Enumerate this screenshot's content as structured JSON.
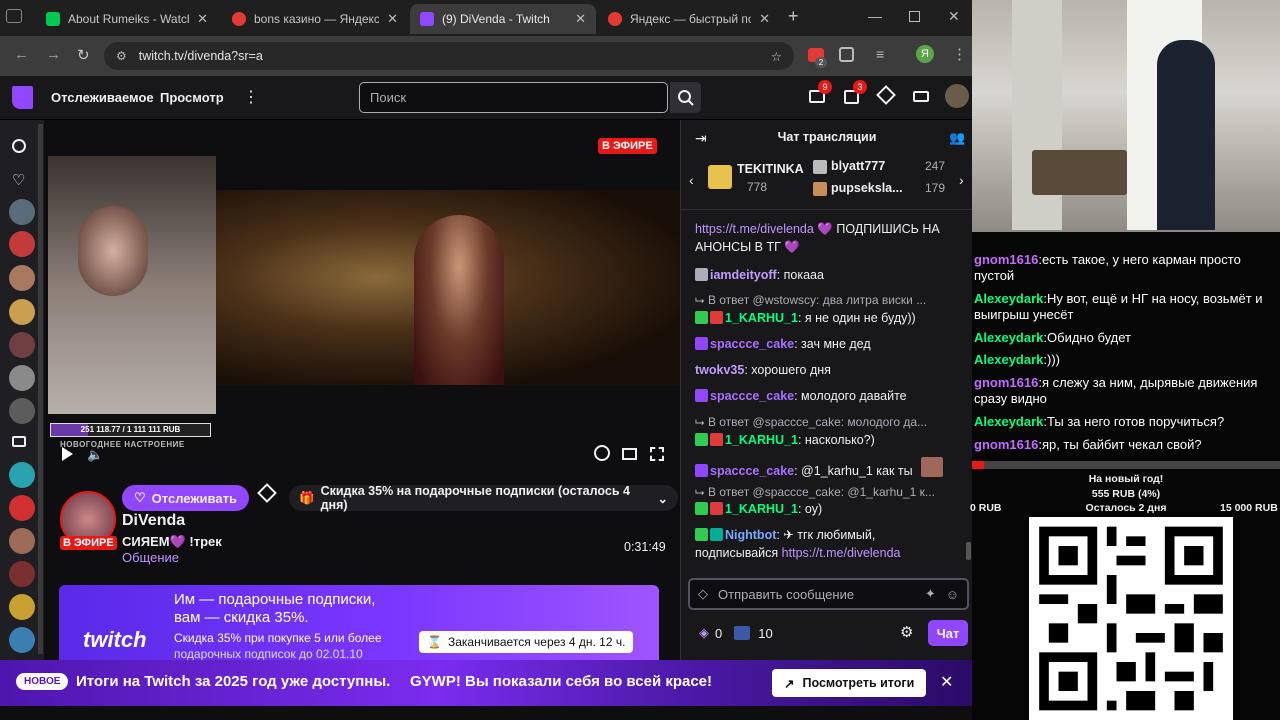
{
  "browser": {
    "tabs": [
      {
        "title": "About Rumeiks - Watch Li",
        "color": "#00c853"
      },
      {
        "title": "bons казино — Яндекс: на",
        "color": "#e53935"
      },
      {
        "title": "(9) DiVenda - Twitch",
        "color": "#9146ff"
      },
      {
        "title": "Яндекс — быстрый поиск",
        "color": "#e53935"
      }
    ],
    "url": "twitch.tv/divenda?sr=a",
    "profile_initial": "Я",
    "ext_badge": "2"
  },
  "nav": {
    "following": "Отслеживаемое",
    "browse": "Просмотр",
    "search_placeholder": "Поиск",
    "inbox_count": "9",
    "notif_count": "3"
  },
  "player": {
    "live_badge": "В ЭФИРЕ",
    "cam_progress_text": "251 118.77 / 1 111 111 RUB",
    "cam_caption": "НОВОГОДНЕЕ НАСТРОЕНИЕ",
    "progress_fraction": 0.23
  },
  "channel": {
    "name": "DiVenda",
    "live_badge": "В ЭФИРЕ",
    "title": "СИЯЕМ💜 !трек",
    "category": "Общение",
    "uptime": "0:31:49",
    "follow_label": "Отслеживать",
    "promo_label": "Скидка 35% на подарочные подписки (осталось 4 дня)"
  },
  "banner": {
    "line1": "Им — подарочные подписки,",
    "line2": "вам — скидка 35%.",
    "line3": "Скидка 35% при покупке 5 или более",
    "line4": "подарочных подписок до 02.01.10",
    "logo": "twitch",
    "timer": "Заканчивается через 4 дн. 12 ч."
  },
  "chat": {
    "header": "Чат трансляции",
    "leaders": [
      {
        "name": "TEKITINKA",
        "value": "778"
      },
      {
        "name": "blyatt777",
        "value": "247"
      },
      {
        "name": "pupseksla...",
        "value": "179"
      }
    ],
    "messages": [
      {
        "link": "https://t.me/divelenda",
        "text": "💜 ПОДПИШИСЬ НА АНОНСЫ В ТГ 💜"
      },
      {
        "nick": "iamdeityoff",
        "text": ": покааа"
      },
      {
        "reply": "В ответ @wstowscy: два литра виски ..."
      },
      {
        "nick": "1_KARHU_1",
        "text": ": я не один не буду))"
      },
      {
        "nick": "spaccce_cake",
        "text": ": зач мне дед"
      },
      {
        "nick": "twokv35",
        "text": ": хорошего дня"
      },
      {
        "nick": "spaccce_cake",
        "text": ": молодого давайте"
      },
      {
        "reply": "В ответ @spaccce_cake: молодого да..."
      },
      {
        "nick": "1_KARHU_1",
        "text": ": насколько?)"
      },
      {
        "nick": "spaccce_cake",
        "text": ": @1_karhu_1 как ты"
      },
      {
        "reply": "В ответ @spaccce_cake: @1_karhu_1 к..."
      },
      {
        "nick": "1_KARHU_1",
        "text": ": оу)"
      },
      {
        "nick": "Nightbot",
        "text": ": ✈ тгк любимый, подписывайся"
      },
      {
        "link": "https://t.me/divelenda"
      }
    ],
    "input_placeholder": "Отправить сообщение",
    "points": "0",
    "extra_count": "10",
    "send_label": "Чат"
  },
  "notice": {
    "tag": "НОВОЕ",
    "text": "Итоги на Twitch за 2025 год уже доступны.",
    "text2": "GYWP! Вы показали себя во всей красе!",
    "button": "Посмотреть итоги"
  },
  "overlay": {
    "lines": [
      {
        "nick": "gnom1616",
        "text": "есть такое, у него карман просто пустой"
      },
      {
        "nick": "Alexeydark",
        "text": "Ну вот, ещё и НГ на носу, возьмёт и выигрыш унесёт"
      },
      {
        "nick": "Alexeydark",
        "text": "Обидно будет"
      },
      {
        "nick": "Alexeydark",
        "text": ")))"
      },
      {
        "nick": "gnom1616",
        "text": "я слежу за ним, дырявые движения сразу видно"
      },
      {
        "nick": "Alexeydark",
        "text": "Ты за него готов поручиться?"
      },
      {
        "nick": "gnom1616",
        "text": "яр, ты байбит чекал свой?"
      }
    ],
    "goal_title": "На новый год!",
    "goal_amount": "555 RUB (4%)",
    "goal_left": "0 RUB",
    "goal_days": "Осталось 2 дня",
    "goal_right": "15 000 RUB",
    "goal_fraction": 0.04
  }
}
